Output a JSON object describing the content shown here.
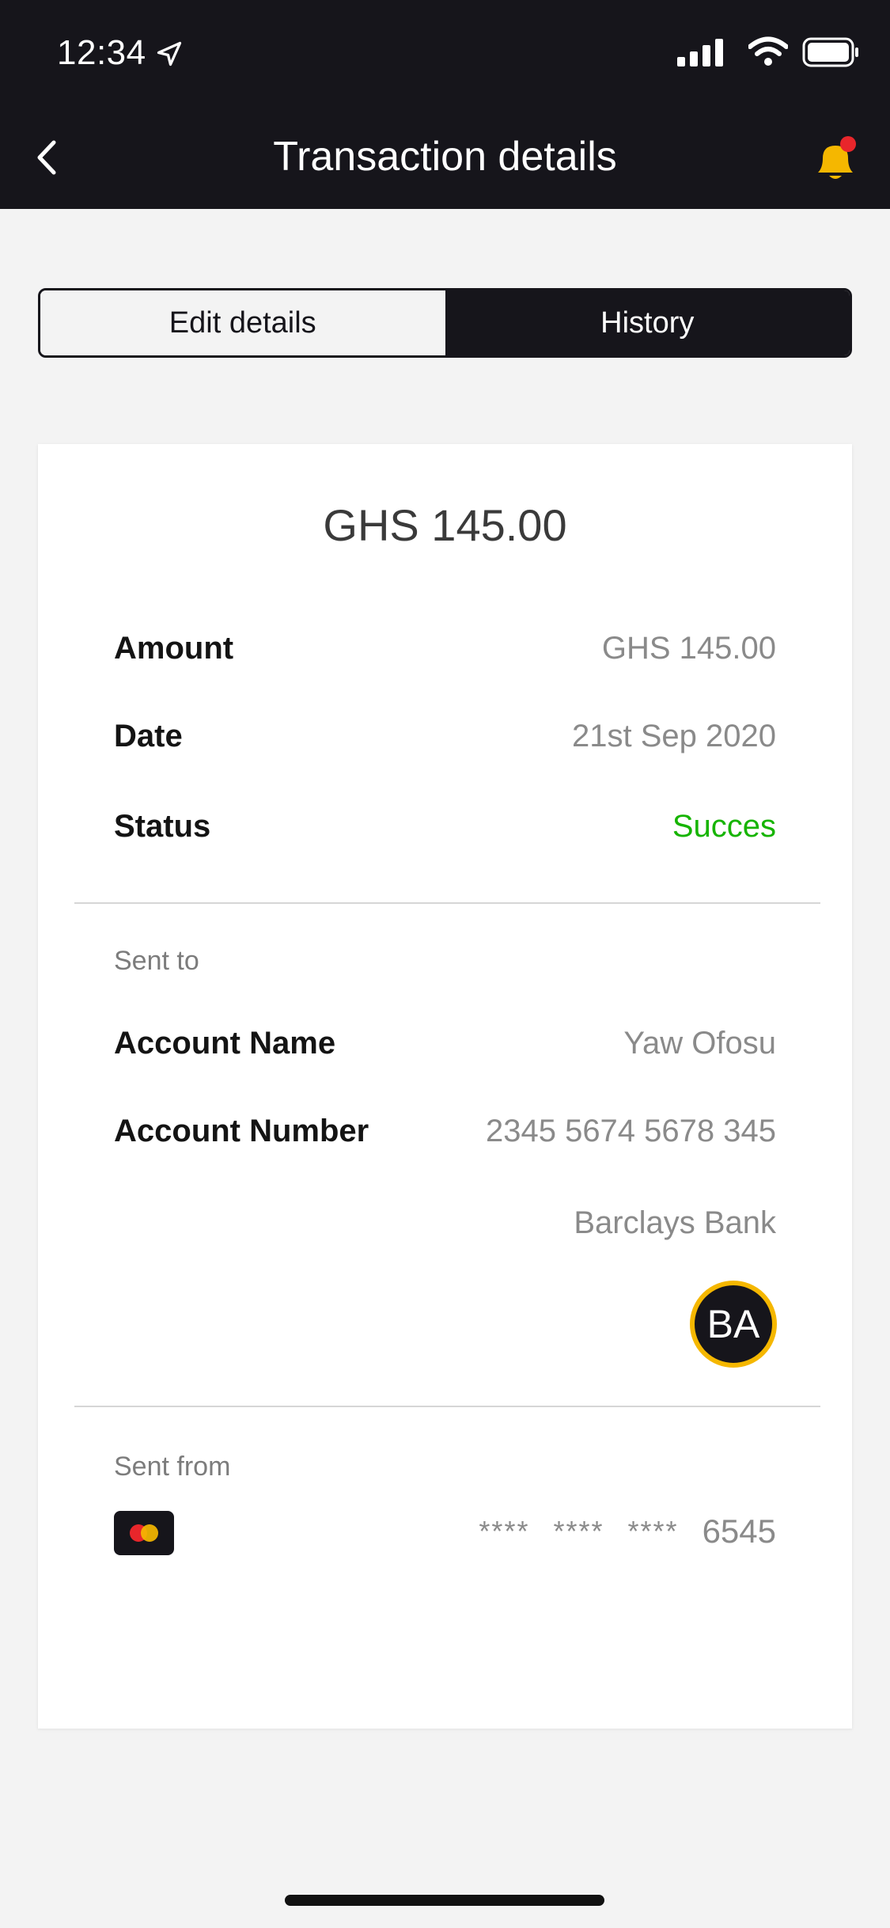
{
  "status_bar": {
    "time": "12:34"
  },
  "header": {
    "title": "Transaction details"
  },
  "tabs": [
    {
      "label": "Edit details",
      "active": false
    },
    {
      "label": "History",
      "active": true
    }
  ],
  "card": {
    "headline_amount": "GHS 145.00",
    "rows": {
      "amount": {
        "label": "Amount",
        "value": "GHS 145.00"
      },
      "date": {
        "label": "Date",
        "value": "21st Sep 2020"
      },
      "status": {
        "label": "Status",
        "value": "Succes"
      }
    },
    "sent_to": {
      "section_label": "Sent to",
      "account_name": {
        "label": "Account Name",
        "value": "Yaw Ofosu"
      },
      "account_number": {
        "label": "Account Number",
        "value": "2345 5674 5678 345"
      },
      "bank_name": "Barclays Bank",
      "bank_initials": "BA"
    },
    "sent_from": {
      "section_label": "Sent from",
      "masked_groups": [
        "****",
        "****",
        "****"
      ],
      "last4": "6545"
    }
  },
  "colors": {
    "header_bg": "#16151b",
    "accent": "#f5b700",
    "success": "#16b400",
    "notification_dot": "#e8262b"
  }
}
